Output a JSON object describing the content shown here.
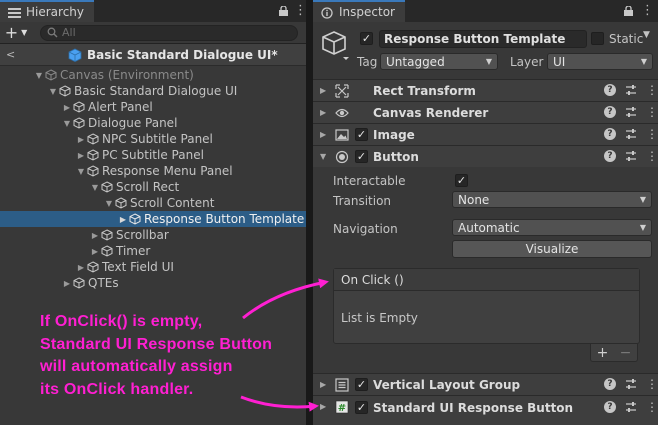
{
  "hierarchy": {
    "tab_label": "Hierarchy",
    "search_placeholder": "All",
    "scene_title": "Basic Standard Dialogue UI*",
    "rows": [
      {
        "label": "Canvas (Environment)"
      },
      {
        "label": "Basic Standard Dialogue UI"
      },
      {
        "label": "Alert Panel"
      },
      {
        "label": "Dialogue Panel"
      },
      {
        "label": "NPC Subtitle Panel"
      },
      {
        "label": "PC Subtitle Panel"
      },
      {
        "label": "Response Menu Panel"
      },
      {
        "label": "Scroll Rect"
      },
      {
        "label": "Scroll Content"
      },
      {
        "label": "Response Button Template"
      },
      {
        "label": "Scrollbar"
      },
      {
        "label": "Timer"
      },
      {
        "label": "Text Field UI"
      },
      {
        "label": "QTEs"
      }
    ]
  },
  "inspector": {
    "tab_label": "Inspector",
    "object_name": "Response Button Template",
    "static_label": "Static",
    "tag_label": "Tag",
    "tag_value": "Untagged",
    "layer_label": "Layer",
    "layer_value": "UI",
    "components": {
      "rect_transform": "Rect Transform",
      "canvas_renderer": "Canvas Renderer",
      "image": "Image",
      "button": "Button",
      "vertical_layout_group": "Vertical Layout Group",
      "standard_ui_response_button": "Standard UI Response Button"
    },
    "button_fields": {
      "interactable_label": "Interactable",
      "transition_label": "Transition",
      "transition_value": "None",
      "navigation_label": "Navigation",
      "navigation_value": "Automatic",
      "visualize_label": "Visualize"
    },
    "onclick": {
      "header": "On Click ()",
      "empty_text": "List is Empty",
      "plus": "+",
      "minus": "−"
    }
  },
  "annotation": {
    "lines": [
      "If OnClick() is empty,",
      "Standard UI Response Button",
      "will automatically assign",
      "its OnClick handler."
    ],
    "color": "#ff1fd2"
  },
  "colors": {
    "selection": "#2c5d87",
    "panel": "#383838",
    "tab_accent": "#3a79bb"
  }
}
